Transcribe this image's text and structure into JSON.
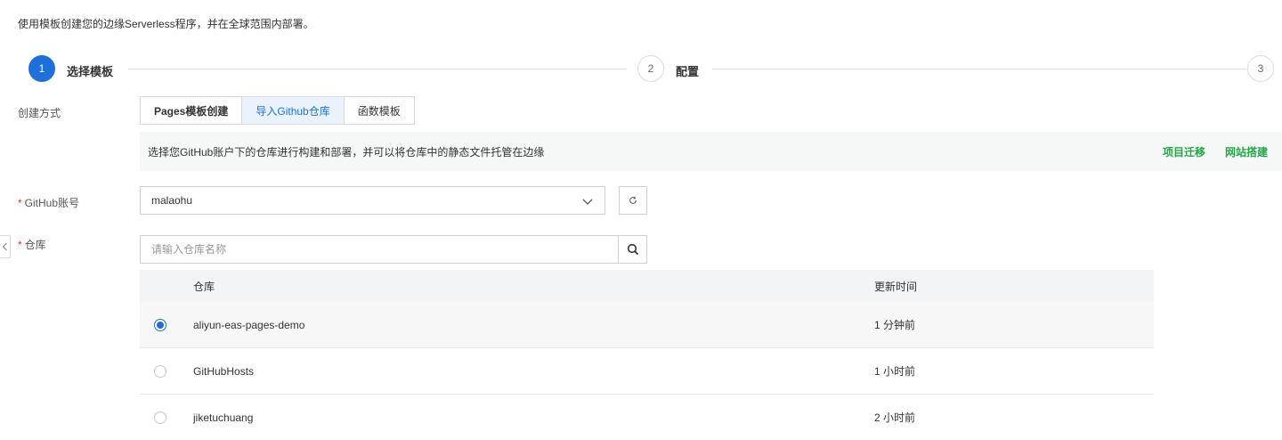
{
  "intro_text": "使用模板创建您的边缘Serverless程序，并在全球范围内部署。",
  "steps": [
    {
      "number": "1",
      "label": "选择模板",
      "state": "active"
    },
    {
      "number": "2",
      "label": "配置",
      "state": "inactive"
    },
    {
      "number": "3",
      "label": "",
      "state": "inactive"
    }
  ],
  "create_method": {
    "label": "创建方式",
    "options": [
      "Pages模板创建",
      "导入Github仓库",
      "函数模板"
    ],
    "selected_index": 1
  },
  "info_bar": {
    "text": "选择您GitHub账户下的仓库进行构建和部署，并可以将仓库中的静态文件托管在边缘",
    "links": [
      "项目迁移",
      "网站搭建"
    ]
  },
  "github_account": {
    "required_mark": "*",
    "label": "GitHub账号",
    "value": "malaohu"
  },
  "repo": {
    "required_mark": "*",
    "label": "仓库",
    "placeholder": "请输入仓库名称"
  },
  "table": {
    "headers": {
      "name": "仓库",
      "updated": "更新时间"
    },
    "rows": [
      {
        "name": "aliyun-eas-pages-demo",
        "updated": "1 分钟前",
        "selected": true
      },
      {
        "name": "GitHubHosts",
        "updated": "1 小时前",
        "selected": false
      },
      {
        "name": "jiketuchuang",
        "updated": "2 小时前",
        "selected": false
      }
    ]
  },
  "colors": {
    "primary": "#1e6fd9",
    "link_green": "#22a745",
    "required_red": "#e0302b"
  }
}
